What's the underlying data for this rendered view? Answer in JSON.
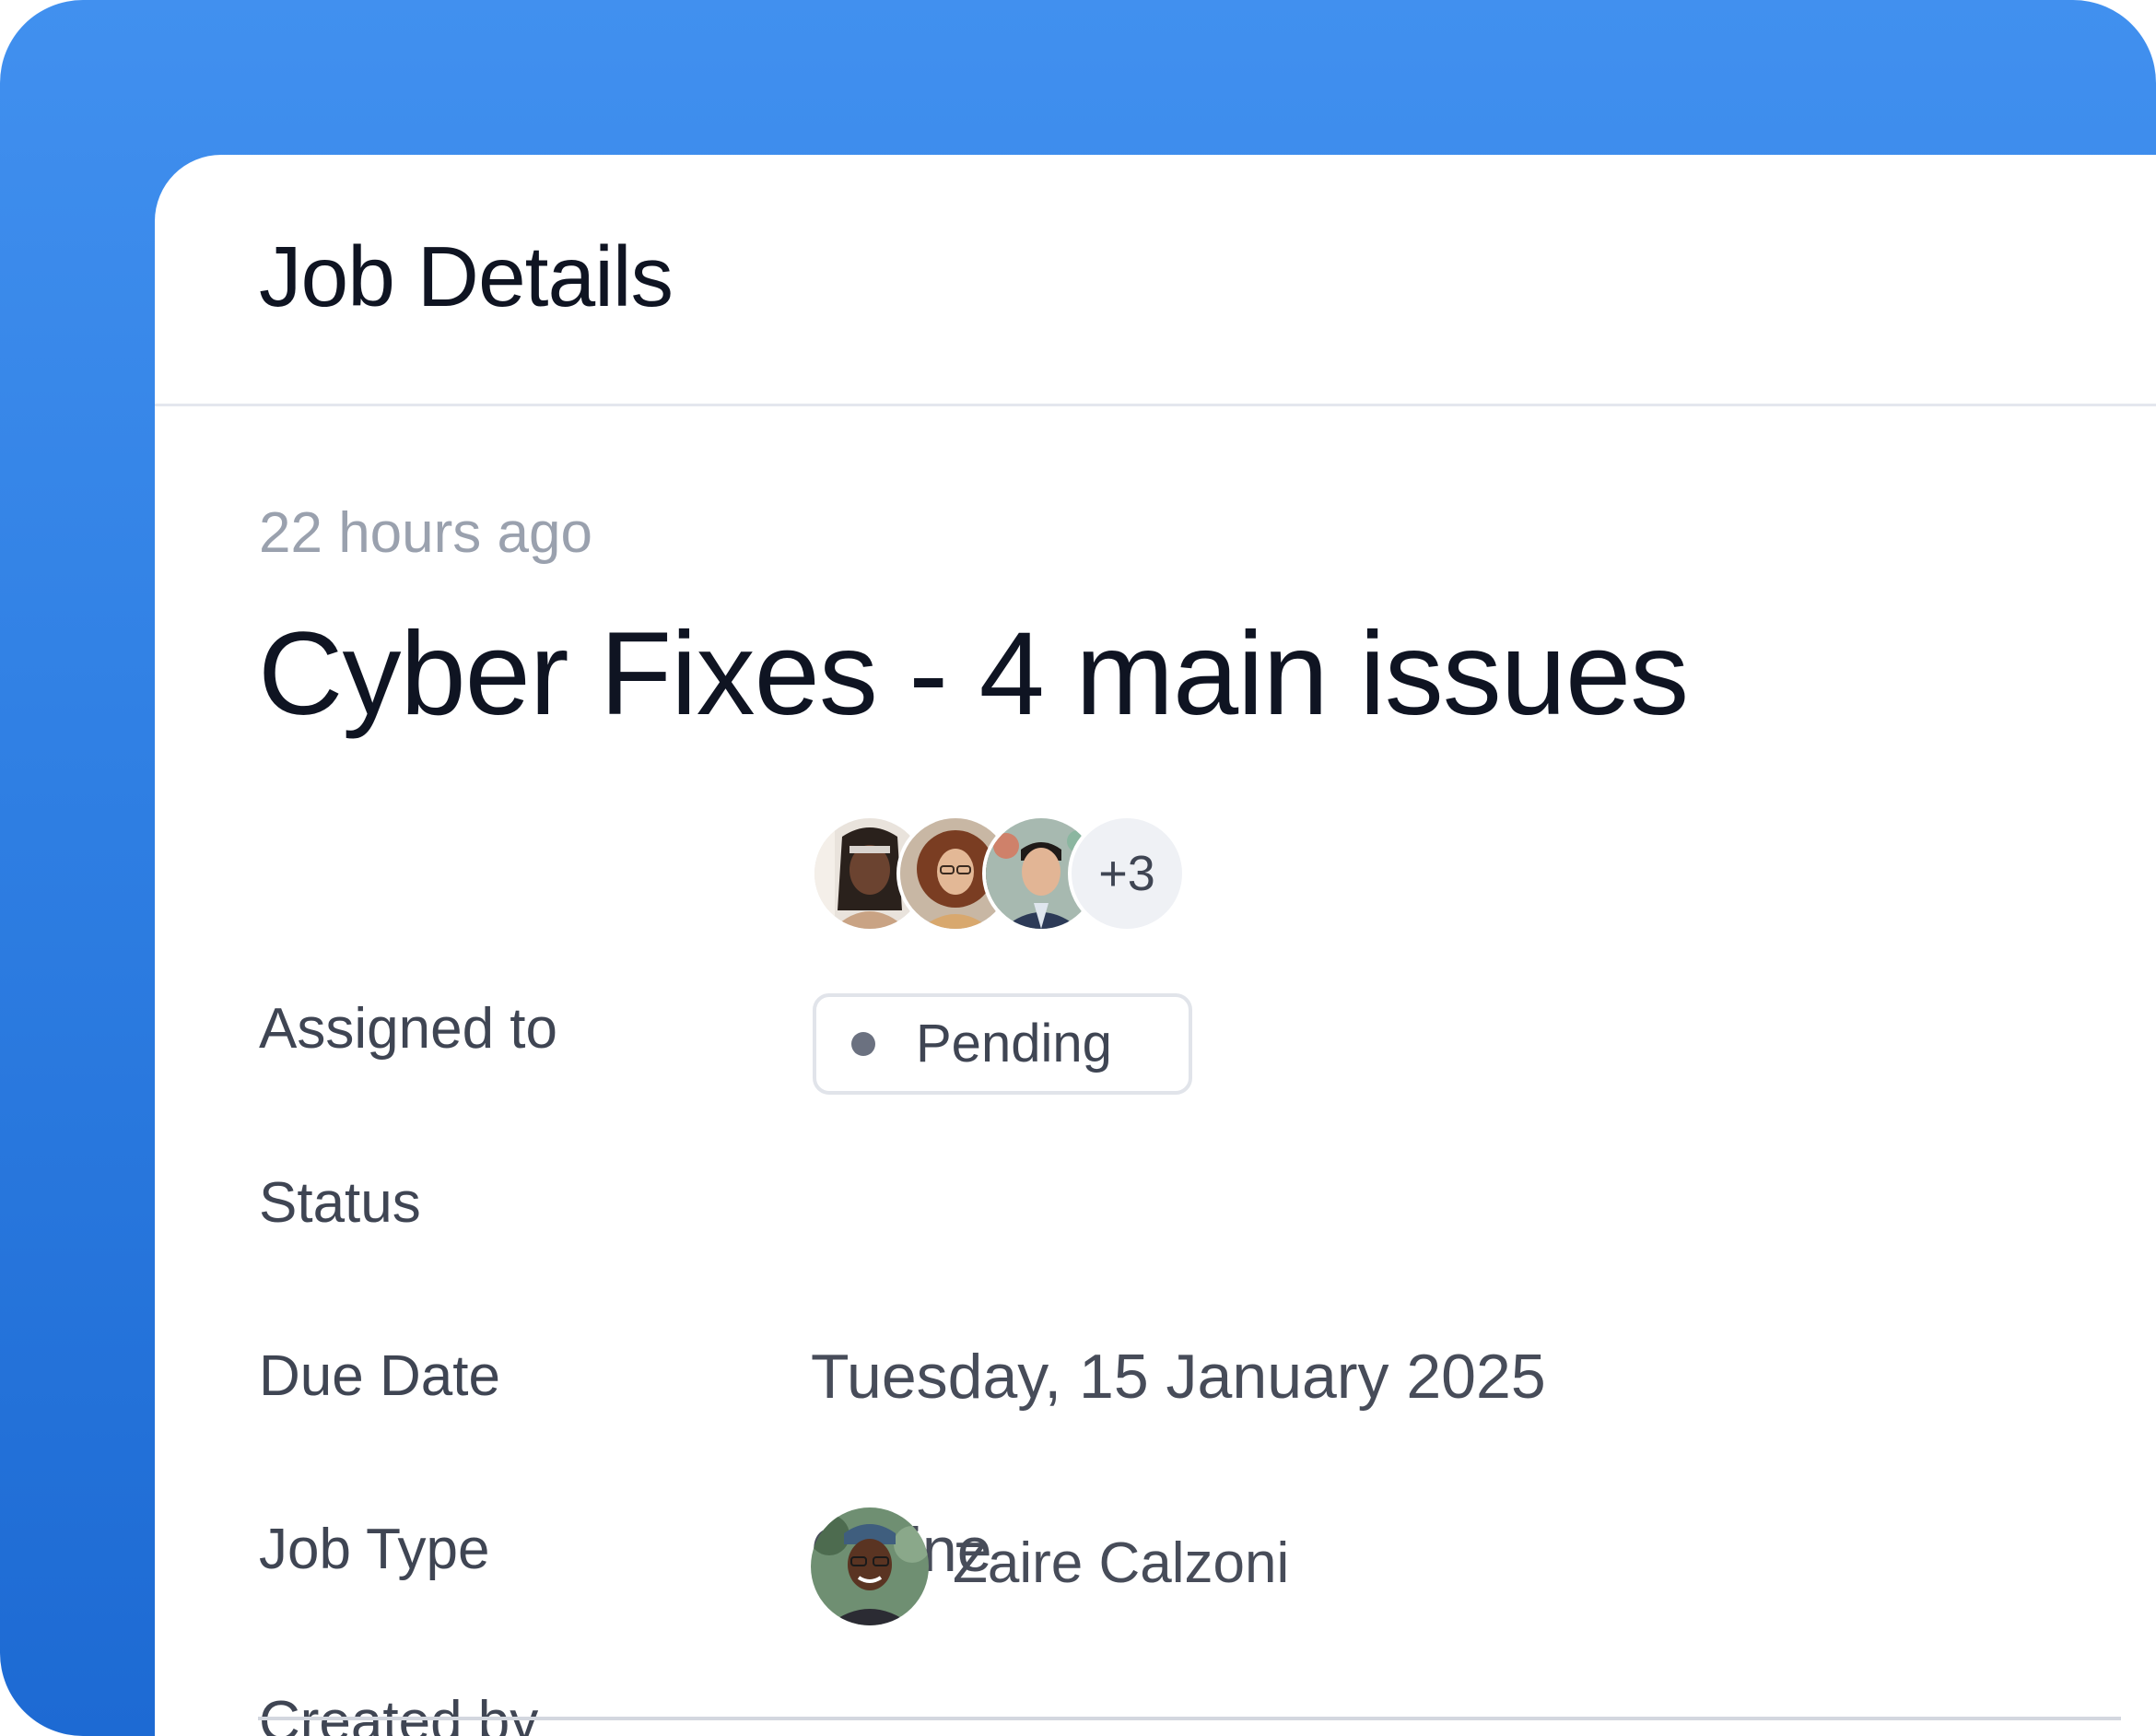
{
  "header": {
    "title": "Job Details"
  },
  "job": {
    "timestamp": "22 hours ago",
    "title": "Cyber Fixes - 4 main issues"
  },
  "fields": {
    "assigned_to": {
      "label": "Assigned to",
      "avatars": [
        "avatar-person-1",
        "avatar-person-2",
        "avatar-person-3"
      ],
      "more_count": "+3"
    },
    "status": {
      "label": "Status",
      "value": "Pending",
      "dot_color": "#6b7180"
    },
    "due_date": {
      "label": "Due Date",
      "value": "Tuesday, 15 January 2025"
    },
    "job_type": {
      "label": "Job Type",
      "value": "Online"
    },
    "created_by": {
      "label": "Created by",
      "name": "Zaire Calzoni"
    }
  },
  "colors": {
    "accent_blue": "#3b8bee",
    "text_primary": "#0f1422",
    "text_muted": "#9aa1ae"
  }
}
